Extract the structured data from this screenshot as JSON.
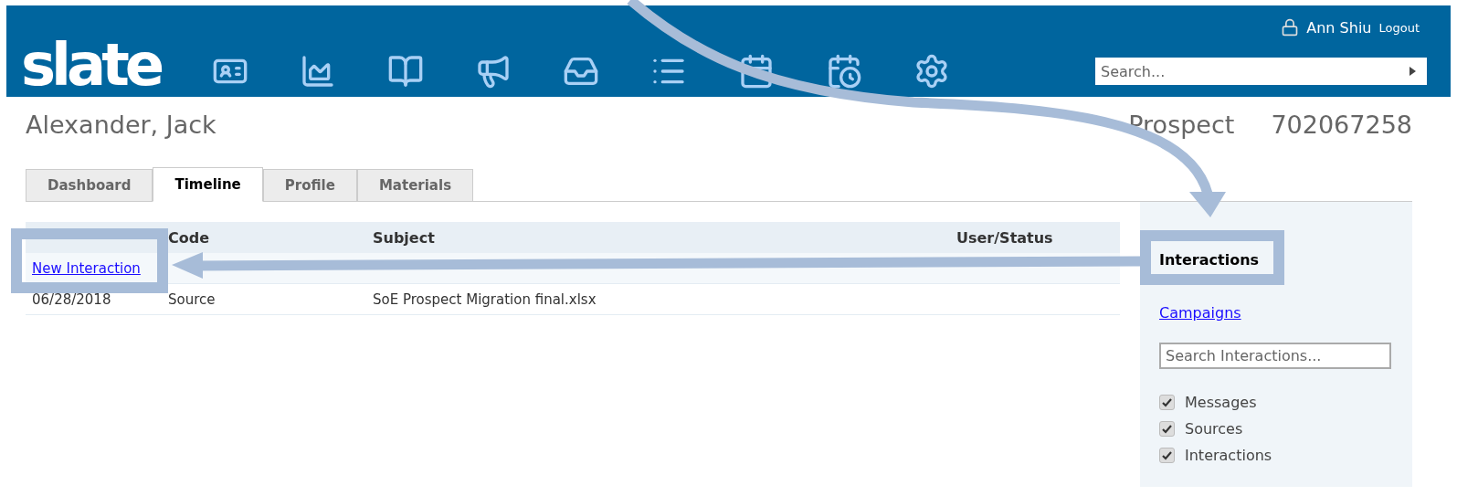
{
  "header": {
    "logo": "slate",
    "user": "Ann Shiu",
    "logout": "Logout",
    "search": {
      "placeholder": "Search..."
    }
  },
  "record": {
    "name": "Alexander, Jack",
    "status": "Prospect",
    "id": "702067258"
  },
  "tabs": [
    {
      "label": "Dashboard",
      "selected": false
    },
    {
      "label": "Timeline",
      "selected": true
    },
    {
      "label": "Profile",
      "selected": false
    },
    {
      "label": "Materials",
      "selected": false
    }
  ],
  "table": {
    "columns": [
      "",
      "Code",
      "Subject",
      "User/Status"
    ],
    "action": "New Interaction",
    "rows": [
      {
        "cells": [
          "06/28/2018",
          "Source",
          "SoE Prospect Migration final.xlsx",
          ""
        ]
      }
    ]
  },
  "sidebar": {
    "links": [
      {
        "label": "Interactions",
        "selected": true
      },
      {
        "label": "Campaigns",
        "selected": false
      }
    ],
    "search": {
      "placeholder": "Search Interactions..."
    },
    "filters": [
      {
        "label": "Messages",
        "checked": true
      },
      {
        "label": "Sources",
        "checked": true
      },
      {
        "label": "Interactions",
        "checked": true
      }
    ]
  }
}
